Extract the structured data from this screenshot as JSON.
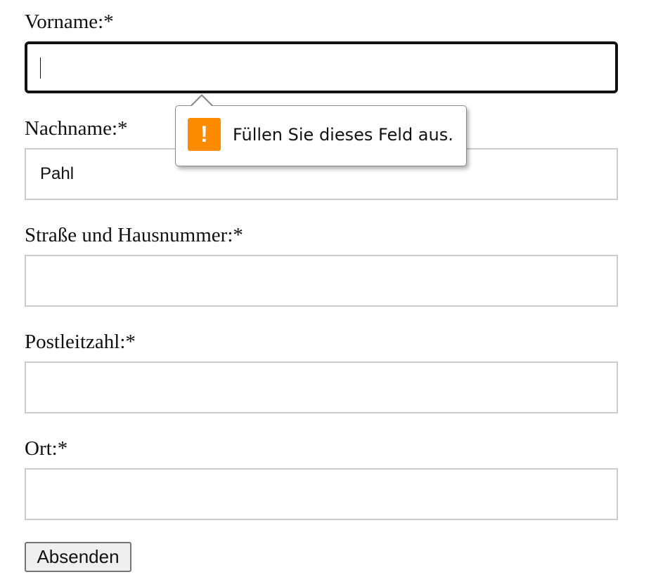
{
  "form": {
    "fields": [
      {
        "label": "Vorname:*",
        "value": ""
      },
      {
        "label": "Nachname:*",
        "value": "Pahl"
      },
      {
        "label": "Straße und Hausnummer:*",
        "value": ""
      },
      {
        "label": "Postleitzahl:*",
        "value": ""
      },
      {
        "label": "Ort:*",
        "value": ""
      }
    ],
    "submit_label": "Absenden"
  },
  "validation_tooltip": {
    "message": "Füllen Sie dieses Feld aus.",
    "icon": "warning-icon",
    "icon_glyph": "!",
    "icon_color": "#ff8c00"
  }
}
